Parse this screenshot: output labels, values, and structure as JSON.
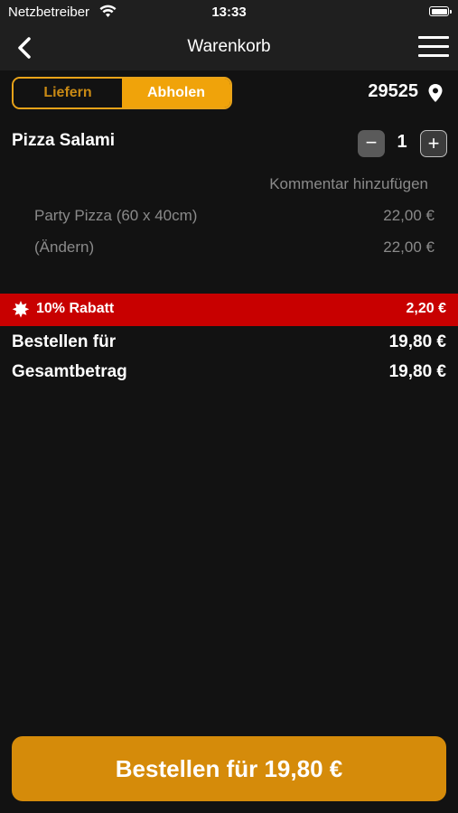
{
  "statusbar": {
    "carrier": "Netzbetreiber",
    "time": "13:33",
    "battery_level": 1.0
  },
  "nav": {
    "title": "Warenkorb",
    "back_icon": "chevron-left-icon",
    "menu_icon": "hamburger-menu-icon"
  },
  "order_mode": {
    "options": [
      "Liefern",
      "Abholen"
    ],
    "selected": "Abholen"
  },
  "location": {
    "zip": "29525",
    "icon": "location-pin-icon"
  },
  "cart_item": {
    "name": "Pizza Salami",
    "quantity": "1",
    "minus_label": "−",
    "plus_label": "+",
    "comment_link": "Kommentar hinzufügen",
    "options": [
      {
        "label": "Party Pizza (60 x 40cm)",
        "price": "22,00 €"
      },
      {
        "label": "(Ändern)",
        "price": "22,00 €"
      }
    ]
  },
  "discount": {
    "label": "10% Rabatt",
    "value": "2,20 €",
    "color": "#c80000"
  },
  "totals": {
    "order_for_label": "Bestellen für",
    "order_for_value": "19,80 €",
    "total_label": "Gesamtbetrag",
    "total_value": "19,80 €"
  },
  "checkout_button": {
    "label": "Bestellen für 19,80 €",
    "color": "#d58b0a"
  },
  "colors": {
    "accent": "#f0a30a",
    "background": "#121212",
    "bar": "#1f1f1f"
  }
}
